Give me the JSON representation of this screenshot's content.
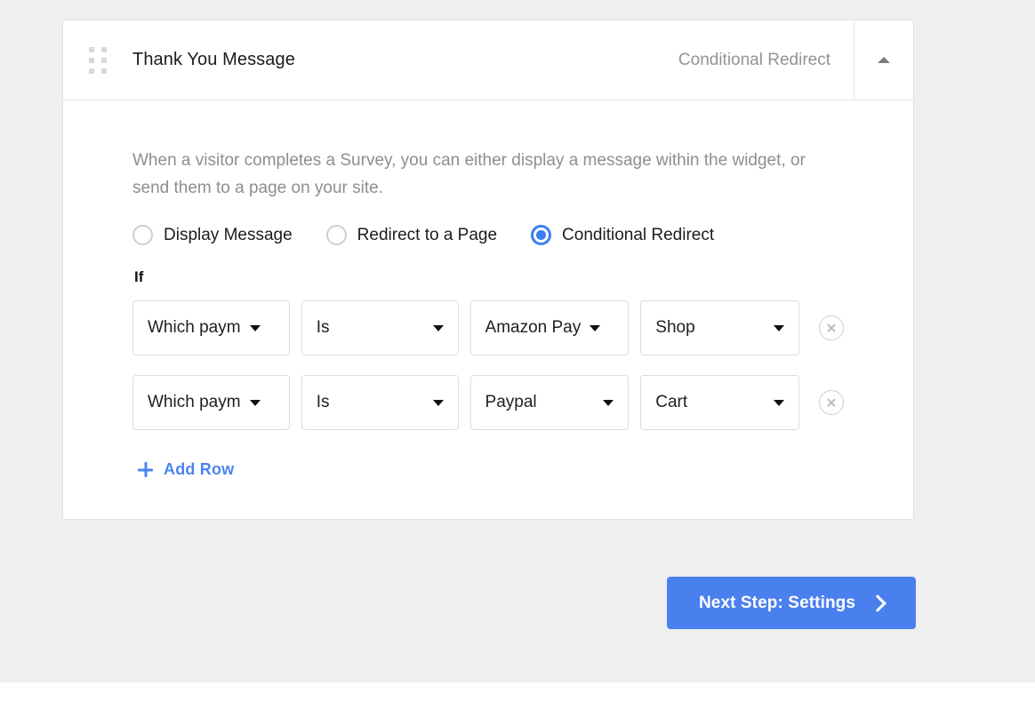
{
  "card": {
    "header": {
      "drag_handle_icon": "drag-dots-icon",
      "title": "Thank You Message",
      "status": "Conditional Redirect",
      "collapse_icon": "caret-up-icon"
    },
    "body": {
      "description": "When a visitor completes a Survey, you can either display a message within the widget, or send them to a page on your site.",
      "radios": [
        {
          "label": "Display Message",
          "checked": false
        },
        {
          "label": "Redirect to a Page",
          "checked": false
        },
        {
          "label": "Conditional Redirect",
          "checked": true
        }
      ],
      "if_label": "If",
      "conditions": [
        {
          "field": "Which paym",
          "operator": "Is",
          "value": "Amazon Pay",
          "destination": "Shop",
          "remove_icon": "close-circle-icon"
        },
        {
          "field": "Which paym",
          "operator": "Is",
          "value": "Paypal",
          "destination": "Cart",
          "remove_icon": "close-circle-icon"
        }
      ],
      "add_row": {
        "icon": "plus-icon",
        "label": "Add Row"
      }
    }
  },
  "footer": {
    "next_button": {
      "label": "Next Step: Settings",
      "icon": "chevron-right-icon"
    }
  },
  "colors": {
    "accent_blue": "#4a80ee",
    "link_blue": "#4a85ef",
    "page_background": "#efefef",
    "card_background": "#ffffff",
    "muted_text": "#8e8e8e"
  }
}
